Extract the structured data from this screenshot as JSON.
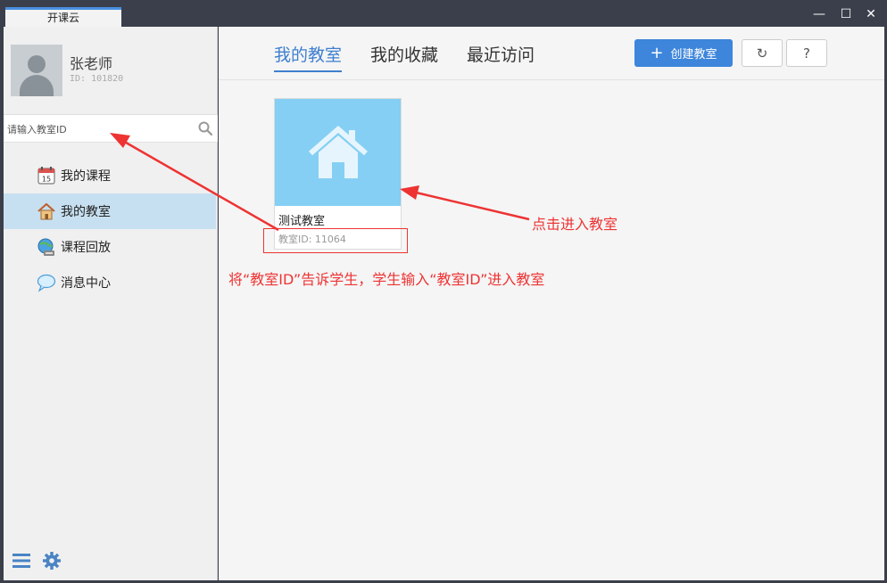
{
  "window": {
    "title": "开课云",
    "minimize_glyph": "—",
    "maximize_glyph": "☐",
    "close_glyph": "✕"
  },
  "profile": {
    "name": "张老师",
    "id_label": "ID: 101820"
  },
  "search": {
    "placeholder": "请输入教室ID",
    "value": ""
  },
  "sidebar": {
    "items": [
      {
        "label": "我的课程",
        "icon": "calendar-icon",
        "active": false
      },
      {
        "label": "我的教室",
        "icon": "house-icon",
        "active": true
      },
      {
        "label": "课程回放",
        "icon": "globe-playback-icon",
        "active": false
      },
      {
        "label": "消息中心",
        "icon": "message-bubble-icon",
        "active": false
      }
    ],
    "calendar_day": "15"
  },
  "tabs": [
    {
      "label": "我的教室",
      "active": true
    },
    {
      "label": "我的收藏",
      "active": false
    },
    {
      "label": "最近访问",
      "active": false
    }
  ],
  "toolbar": {
    "create_label": "创建教室",
    "create_icon": "+",
    "refresh_glyph": "↻",
    "help_glyph": "?"
  },
  "room": {
    "title": "测试教室",
    "id_text": "教室ID: 11064"
  },
  "annotations": {
    "click_hint": "点击进入教室",
    "share_hint": "将“教室ID”告诉学生，学生输入“教室ID”进入教室"
  },
  "colors": {
    "accent": "#3d86db",
    "thumbnail": "#85cff4",
    "annotation": "#e33333",
    "active_nav": "#c7e0f1"
  }
}
